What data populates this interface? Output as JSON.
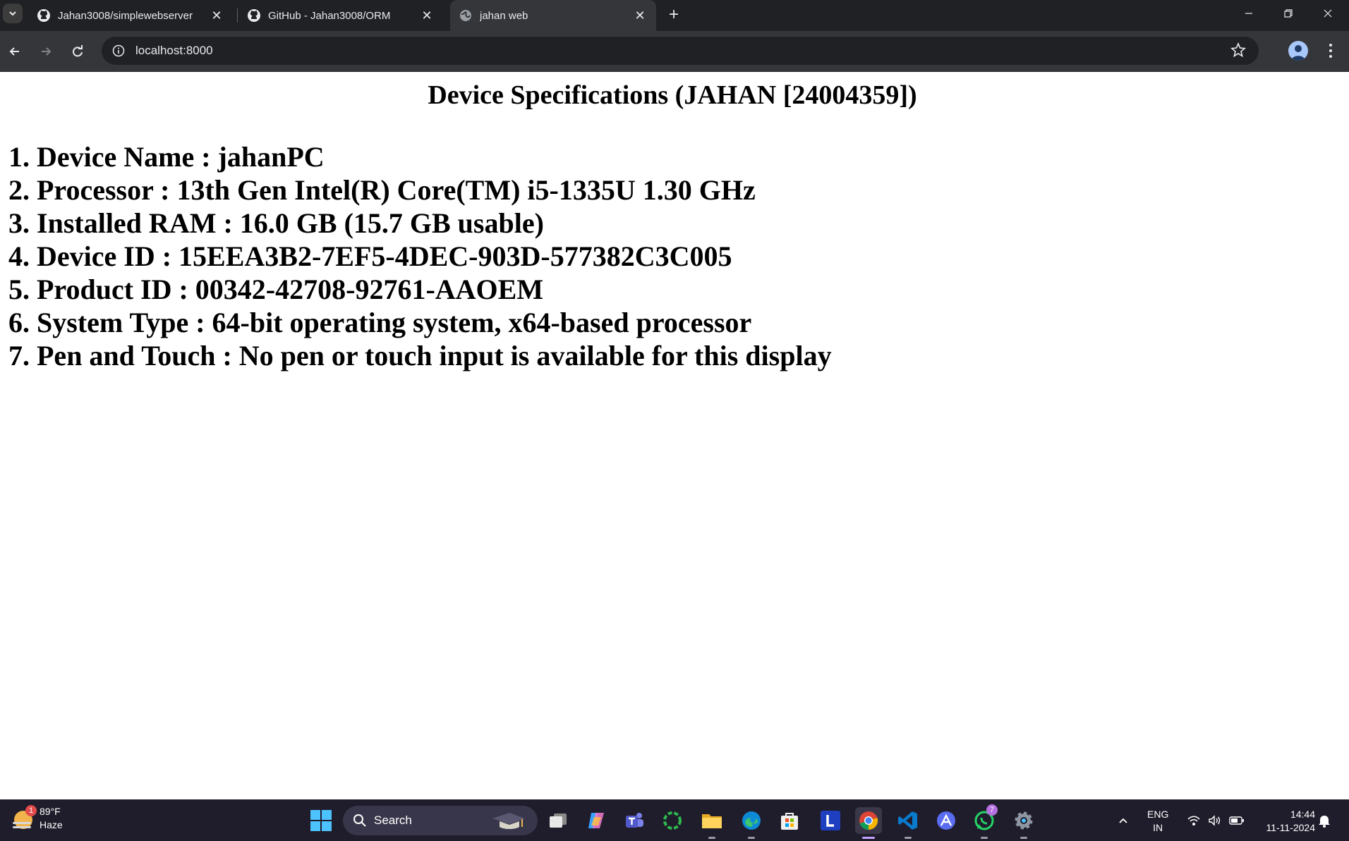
{
  "browser": {
    "tabs": [
      {
        "title": "Jahan3008/simplewebserver",
        "icon": "github-icon",
        "active": false
      },
      {
        "title": "GitHub - Jahan3008/ORM",
        "icon": "github-icon",
        "active": false
      },
      {
        "title": "jahan web",
        "icon": "globe-icon",
        "active": true
      }
    ],
    "url": "localhost:8000"
  },
  "page": {
    "heading": "Device Specifications (JAHAN [24004359])",
    "specs": [
      "1. Device Name : jahanPC",
      "2. Processor : 13th Gen Intel(R) Core(TM) i5-1335U 1.30 GHz",
      "3. Installed RAM : 16.0 GB (15.7 GB usable)",
      "4. Device ID : 15EEA3B2-7EF5-4DEC-903D-577382C3C005",
      "5. Product ID : 00342-42708-92761-AAOEM",
      "6. System Type : 64-bit operating system, x64-based processor",
      "7. Pen and Touch : No pen or touch input is available for this display"
    ]
  },
  "taskbar": {
    "weather": {
      "temp": "89°F",
      "condition": "Haze",
      "badge": "1"
    },
    "search_label": "Search",
    "whatsapp_badge": "7",
    "language": {
      "line1": "ENG",
      "line2": "IN"
    },
    "time": "14:44",
    "date": "11-11-2024"
  }
}
